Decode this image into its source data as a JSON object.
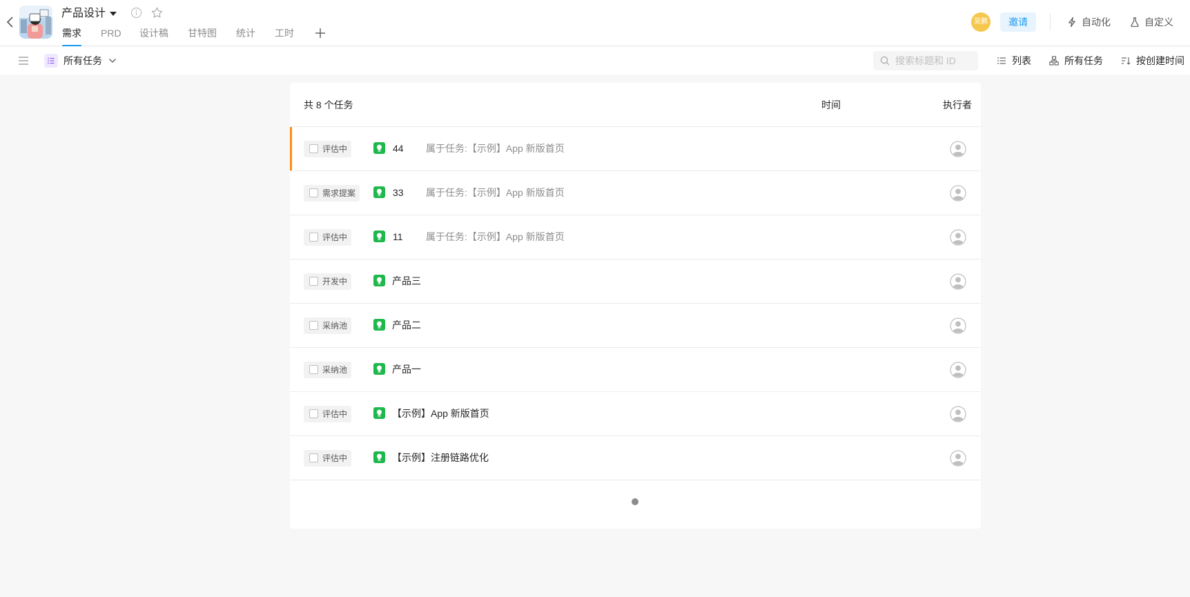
{
  "header": {
    "project_title": "产品设计",
    "tabs": [
      {
        "label": "需求",
        "active": true
      },
      {
        "label": "PRD"
      },
      {
        "label": "设计稿"
      },
      {
        "label": "甘特图"
      },
      {
        "label": "统计"
      },
      {
        "label": "工时"
      }
    ],
    "user_avatar_text": "吴鹏",
    "invite_label": "邀请",
    "automation_label": "自动化",
    "customize_label": "自定义"
  },
  "toolbar": {
    "view_title": "所有任务",
    "search_placeholder": "搜索标题和 ID",
    "list_label": "列表",
    "filter_label": "所有任务",
    "sort_label": "按创建时间"
  },
  "panel": {
    "count_label": "共 8 个任务",
    "col_time": "时间",
    "col_assignee": "执行者",
    "rows": [
      {
        "status": "评估中",
        "id": "44",
        "parent": "属于任务:【示例】App 新版首页",
        "highlight": true
      },
      {
        "status": "需求提案",
        "id": "33",
        "parent": "属于任务:【示例】App 新版首页"
      },
      {
        "status": "评估中",
        "id": "11",
        "parent": "属于任务:【示例】App 新版首页"
      },
      {
        "status": "开发中",
        "name": "产品三"
      },
      {
        "status": "采纳池",
        "name": "产品二"
      },
      {
        "status": "采纳池",
        "name": "产品一"
      },
      {
        "status": "评估中",
        "name": "【示例】App 新版首页"
      },
      {
        "status": "评估中",
        "name": "【示例】注册链路优化"
      }
    ]
  },
  "colors": {
    "accent": "#1b9aee",
    "highlight_bar": "#fa8c16",
    "requirement_icon": "#1fb84d",
    "avatar_bg": "#f5c74c"
  }
}
